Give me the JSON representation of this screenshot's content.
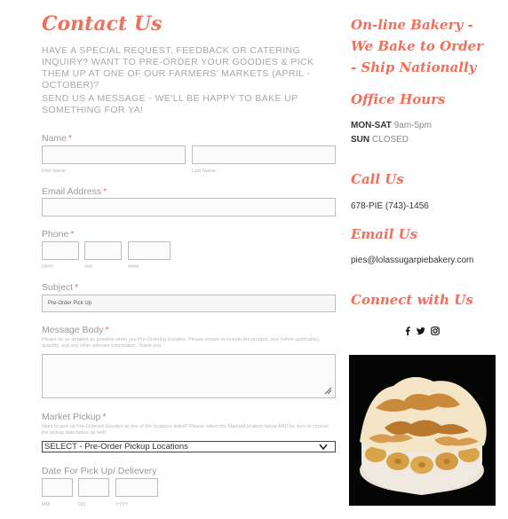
{
  "form": {
    "title": "Contact Us",
    "intro": "HAVE A SPECIAL REQUEST, FEEDBACK OR CATERING INQUIRY? WANT TO PRE-ORDER YOUR GOODIES & PICK THEM UP AT ONE OF OUR FARMERS' MARKETS (APRIL - OCTOBER)?",
    "intro2": "SEND US A MESSAGE - WE'LL BE HAPPY TO BAKE UP SOMETHING FOR YA!",
    "required_mark": "*",
    "name": {
      "label": "Name",
      "first": "First Name",
      "last": "Last Name"
    },
    "email": {
      "label": "Email Address"
    },
    "phone": {
      "label": "Phone",
      "p1": "(###)",
      "p2": "###",
      "p3": "####"
    },
    "subject": {
      "label": "Subject",
      "value": "Pre-Order Pick Up"
    },
    "message": {
      "label": "Message Body",
      "help": "Please be as detailed as possible when you Pre-Ordering Goodies. Please ensure to include the product, size (when applicable), quantity, and any other relevant information.  Thank you."
    },
    "market": {
      "label": "Market Pickup",
      "help": "Want to pick up Pre-Ordered Goodies at one of the locations listed?  Please select the Market/Location below AND be sure to choose the pickup date below as well.",
      "value": "SELECT - Pre-Order Pickup Locations"
    },
    "date": {
      "label": "Date For Pick Up/ Delievery",
      "mm": "MM",
      "dd": "DD",
      "yyyy": "YYYY"
    }
  },
  "sidebar": {
    "tagline": "On-line Bakery - We Bake to Order - Ship Nationally",
    "hours_title": "Office Hours",
    "hours": [
      {
        "days": "MON-SAT",
        "time": "9am-5pm"
      },
      {
        "days": "SUN",
        "time": "CLOSED"
      }
    ],
    "call_title": "Call Us",
    "phone": "678-PIE (743)-1456",
    "email_title": "Email Us",
    "email": "pies@lolassugarpiebakery.com",
    "connect_title": "Connect with Us",
    "social_icons": [
      "facebook-icon",
      "twitter-icon",
      "instagram-icon"
    ]
  },
  "colors": {
    "accent": "#f36f5b",
    "text": "#9a9a9a",
    "dark": "#333333"
  }
}
